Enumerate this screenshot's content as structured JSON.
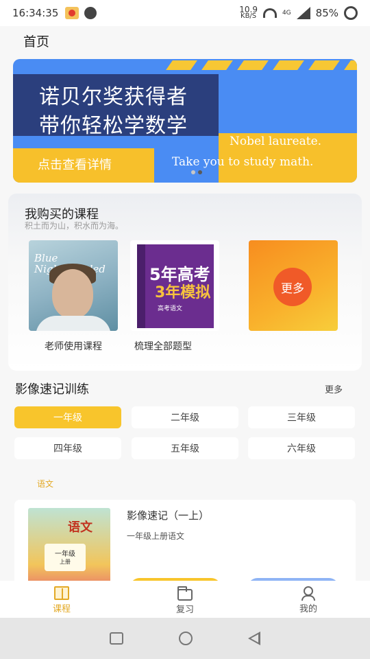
{
  "status_bar": {
    "time": "16:34:35",
    "net_speed_value": "10.9",
    "net_speed_unit": "KB/S",
    "network_type": "4G",
    "battery": "85%"
  },
  "header": {
    "title": "首页"
  },
  "banner": {
    "cn_line1": "诺贝尔奖获得者",
    "cn_line2": "带你轻松学数学",
    "cta": "点击查看详情",
    "en_line1": "Nobel laureate.",
    "en_line2": "Take you to study math.",
    "slide_count": 2,
    "active_slide": 2
  },
  "my_courses": {
    "title": "我购买的课程",
    "subtitle": "积土而为山，积水而为海。",
    "items": [
      {
        "label": "老师使用课程",
        "cover_title": "Blue Nightcrawled"
      },
      {
        "label": "梳理全部题型",
        "cover_line1": "5年高考",
        "cover_line2": "3年模拟",
        "cover_sub": "高考语文"
      }
    ],
    "more_label": "更多"
  },
  "training": {
    "title": "影像速记训练",
    "more_label": "更多",
    "grades": [
      "一年级",
      "二年级",
      "三年级",
      "四年级",
      "五年级",
      "六年级"
    ],
    "selected_grade": "一年级",
    "subject": "语文",
    "book": {
      "cover_title": "语文",
      "cover_grade": "一年级",
      "cover_volume": "上册",
      "name": "影像速记（一上）",
      "desc": "一年级上册语文"
    }
  },
  "bottom_nav": {
    "items": [
      "课程",
      "复习",
      "我的"
    ],
    "active": "课程"
  },
  "colors": {
    "accent": "#f8c52c",
    "banner_blue": "#4a8cf3",
    "banner_navy": "#2b3f7d",
    "more_orange": "#f05a28"
  }
}
